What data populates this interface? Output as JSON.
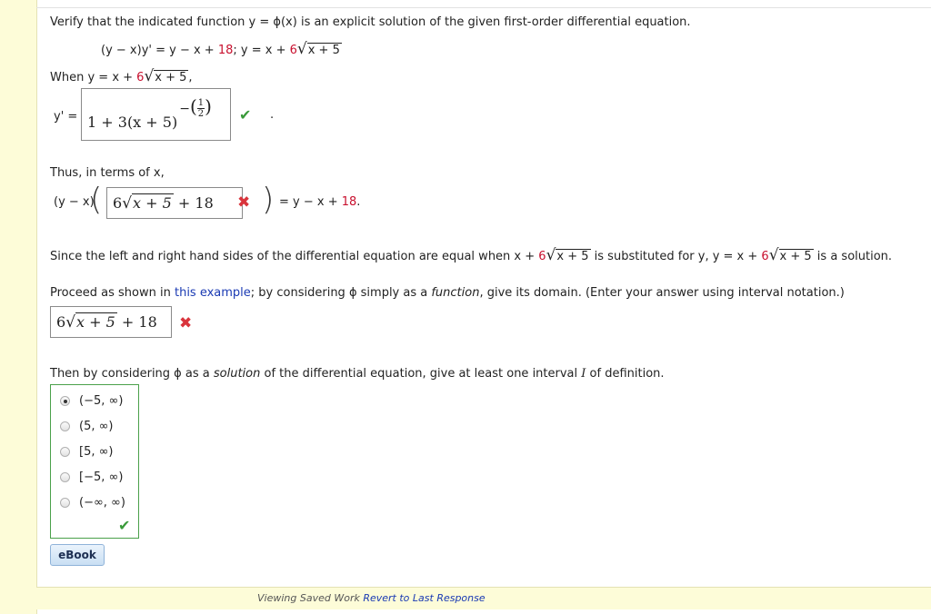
{
  "question": {
    "intro": "Verify that the indicated function  y = ϕ(x)  is an explicit solution of the given first-order differential equation.",
    "equation_lhs": "(y − x)y' = y − x + ",
    "equation_const": "18",
    "equation_sep": ";     y = x + ",
    "equation_coef": "6",
    "equation_rad": "x + 5"
  },
  "when": {
    "prefix": "When  y = x + ",
    "coef": "6",
    "rad": "x + 5",
    "suffix": ","
  },
  "yprime": {
    "label": "y' =",
    "answer_base": "1 + 3(x + 5)",
    "answer_exp_sign": "−",
    "answer_exp_num": "1",
    "answer_exp_den": "2",
    "status": "correct",
    "trailing": "."
  },
  "thus": {
    "label": "Thus, in terms of x,",
    "lhs_prefix": "(y − x)",
    "answer_coef": "6",
    "answer_rad": "x + 5",
    "answer_tail": " + 18",
    "status": "incorrect",
    "rhs_prefix": "= y − x + ",
    "rhs_const": "18",
    "rhs_suffix": "."
  },
  "since": {
    "part1": "Since the left and right hand sides of the differential equation are equal when  x + ",
    "coef1": "6",
    "rad1": "x + 5",
    "part2": "  is substituted for y,  y = x + ",
    "coef2": "6",
    "rad2": "x + 5",
    "part3": "  is a solution."
  },
  "domain": {
    "prompt_a": "Proceed as shown in ",
    "link": "this example",
    "prompt_b": "; by considering ϕ simply as a ",
    "prompt_fn": "function",
    "prompt_c": ", give its domain. (Enter your answer using interval notation.)",
    "answer_coef": "6",
    "answer_rad": "x + 5",
    "answer_tail": " + 18",
    "status": "incorrect"
  },
  "interval": {
    "prompt_a": "Then by considering ϕ as a ",
    "prompt_sol": "solution",
    "prompt_b": " of the differential equation, give at least one interval ",
    "prompt_I": "I",
    "prompt_c": " of definition.",
    "options": [
      "(−5, ∞)",
      "(5, ∞)",
      "[5, ∞)",
      "[−5, ∞)",
      "(−∞, ∞)"
    ],
    "selected_index": 0,
    "status": "correct"
  },
  "ebook_label": "eBook",
  "footer": {
    "saved_text": "Viewing Saved Work",
    "revert_link": "Revert to Last Response"
  },
  "colors": {
    "accent_red": "#c8102e",
    "link_blue": "#1a3ab3",
    "correct_green": "#3a9a3a",
    "incorrect_red": "#d9343c",
    "side_yellow": "#fdfcd8"
  },
  "icons": {
    "correct": "check-icon",
    "incorrect": "cross-icon"
  }
}
